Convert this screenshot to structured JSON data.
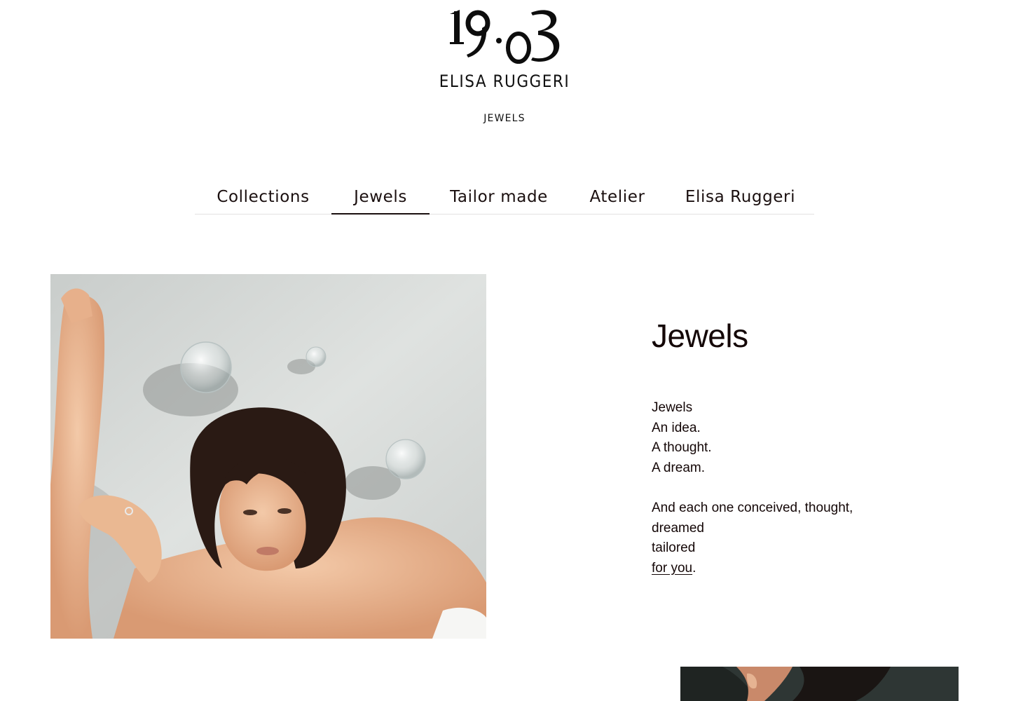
{
  "header": {
    "logo_mark": "19·03",
    "brand_name": "ELISA RUGGERI",
    "section_label": "JEWELS"
  },
  "nav": {
    "items": [
      {
        "label": "Collections",
        "active": false
      },
      {
        "label": "Jewels",
        "active": true
      },
      {
        "label": "Tailor made",
        "active": false
      },
      {
        "label": "Atelier",
        "active": false
      },
      {
        "label": "Elisa Ruggeri",
        "active": false
      }
    ]
  },
  "main": {
    "title": "Jewels",
    "lines": [
      "Jewels",
      "An idea.",
      "A thought.",
      "A dream."
    ],
    "paragraph_lines": [
      "And each one conceived, thought,",
      "dreamed",
      "tailored"
    ],
    "link_text": "for you",
    "link_suffix": "."
  },
  "colors": {
    "text": "#140707",
    "background": "#ffffff",
    "divider": "#e4e2e2"
  }
}
